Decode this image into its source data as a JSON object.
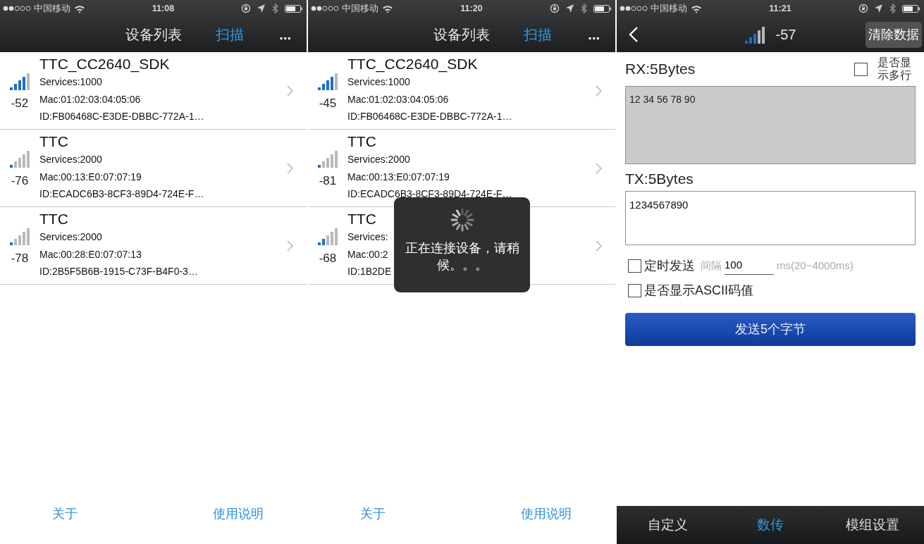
{
  "panels": [
    {
      "kind": "device_list",
      "status_bar": {
        "carrier": "中国移动",
        "time": "11:08"
      },
      "nav": {
        "title": "设备列表",
        "scan": "扫描",
        "more": "..."
      },
      "devices": [
        {
          "name": "TTC_CC2640_SDK",
          "rssi": "-52",
          "services": "Services:1000",
          "mac": "Mac:01:02:03:04:05:06",
          "id": "ID:FB06468C-E3DE-DBBC-772A-1…"
        },
        {
          "name": "TTC",
          "rssi": "-76",
          "services": "Services:2000",
          "mac": "Mac:00:13:E0:07:07:19",
          "id": "ID:ECADC6B3-8CF3-89D4-724E-F…"
        },
        {
          "name": "TTC",
          "rssi": "-78",
          "services": "Services:2000",
          "mac": "Mac:00:28:E0:07:07:13",
          "id": "ID:2B5F5B6B-1915-C73F-B4F0-3…"
        }
      ],
      "footer_links": [
        "关于",
        "使用说明"
      ]
    },
    {
      "kind": "device_list",
      "status_bar": {
        "carrier": "中国移动",
        "time": "11:20"
      },
      "nav": {
        "title": "设备列表",
        "scan": "扫描",
        "more": "..."
      },
      "devices": [
        {
          "name": "TTC_CC2640_SDK",
          "rssi": "-45",
          "services": "Services:1000",
          "mac": "Mac:01:02:03:04:05:06",
          "id": "ID:FB06468C-E3DE-DBBC-772A-1…"
        },
        {
          "name": "TTC",
          "rssi": "-81",
          "services": "Services:2000",
          "mac": "Mac:00:13:E0:07:07:19",
          "id": "ID:ECADC6B3-8CF3-89D4-724E-F…"
        },
        {
          "name": "TTC",
          "rssi": "-68",
          "services": "Services:",
          "mac": "Mac:00:2",
          "id": "ID:1B2DE"
        }
      ],
      "footer_links": [
        "关于",
        "使用说明"
      ],
      "toast": {
        "message": "正在连接设备，请稍候。。。"
      }
    },
    {
      "kind": "data_transfer",
      "status_bar": {
        "carrier": "中国移动",
        "time": "11:21"
      },
      "nav": {
        "rssi": "-57",
        "clear_button": "清除数据"
      },
      "rx": {
        "label": "RX:5Bytes",
        "multiline_label": "是否显示多行",
        "multiline_checked": false,
        "data": "12 34 56 78 90"
      },
      "tx": {
        "label": "TX:5Bytes",
        "value": "1234567890"
      },
      "timed_send": {
        "label": "定时发送",
        "checked": false,
        "interval_label": "间隔",
        "interval": "100",
        "unit": "ms(20~4000ms)"
      },
      "ascii": {
        "label": "是否显示ASCII码值",
        "checked": false
      },
      "send_button": "发送5个字节",
      "tabs": [
        {
          "label": "自定义",
          "selected": false
        },
        {
          "label": "数传",
          "selected": true
        },
        {
          "label": "模组设置",
          "selected": false
        }
      ]
    }
  ]
}
